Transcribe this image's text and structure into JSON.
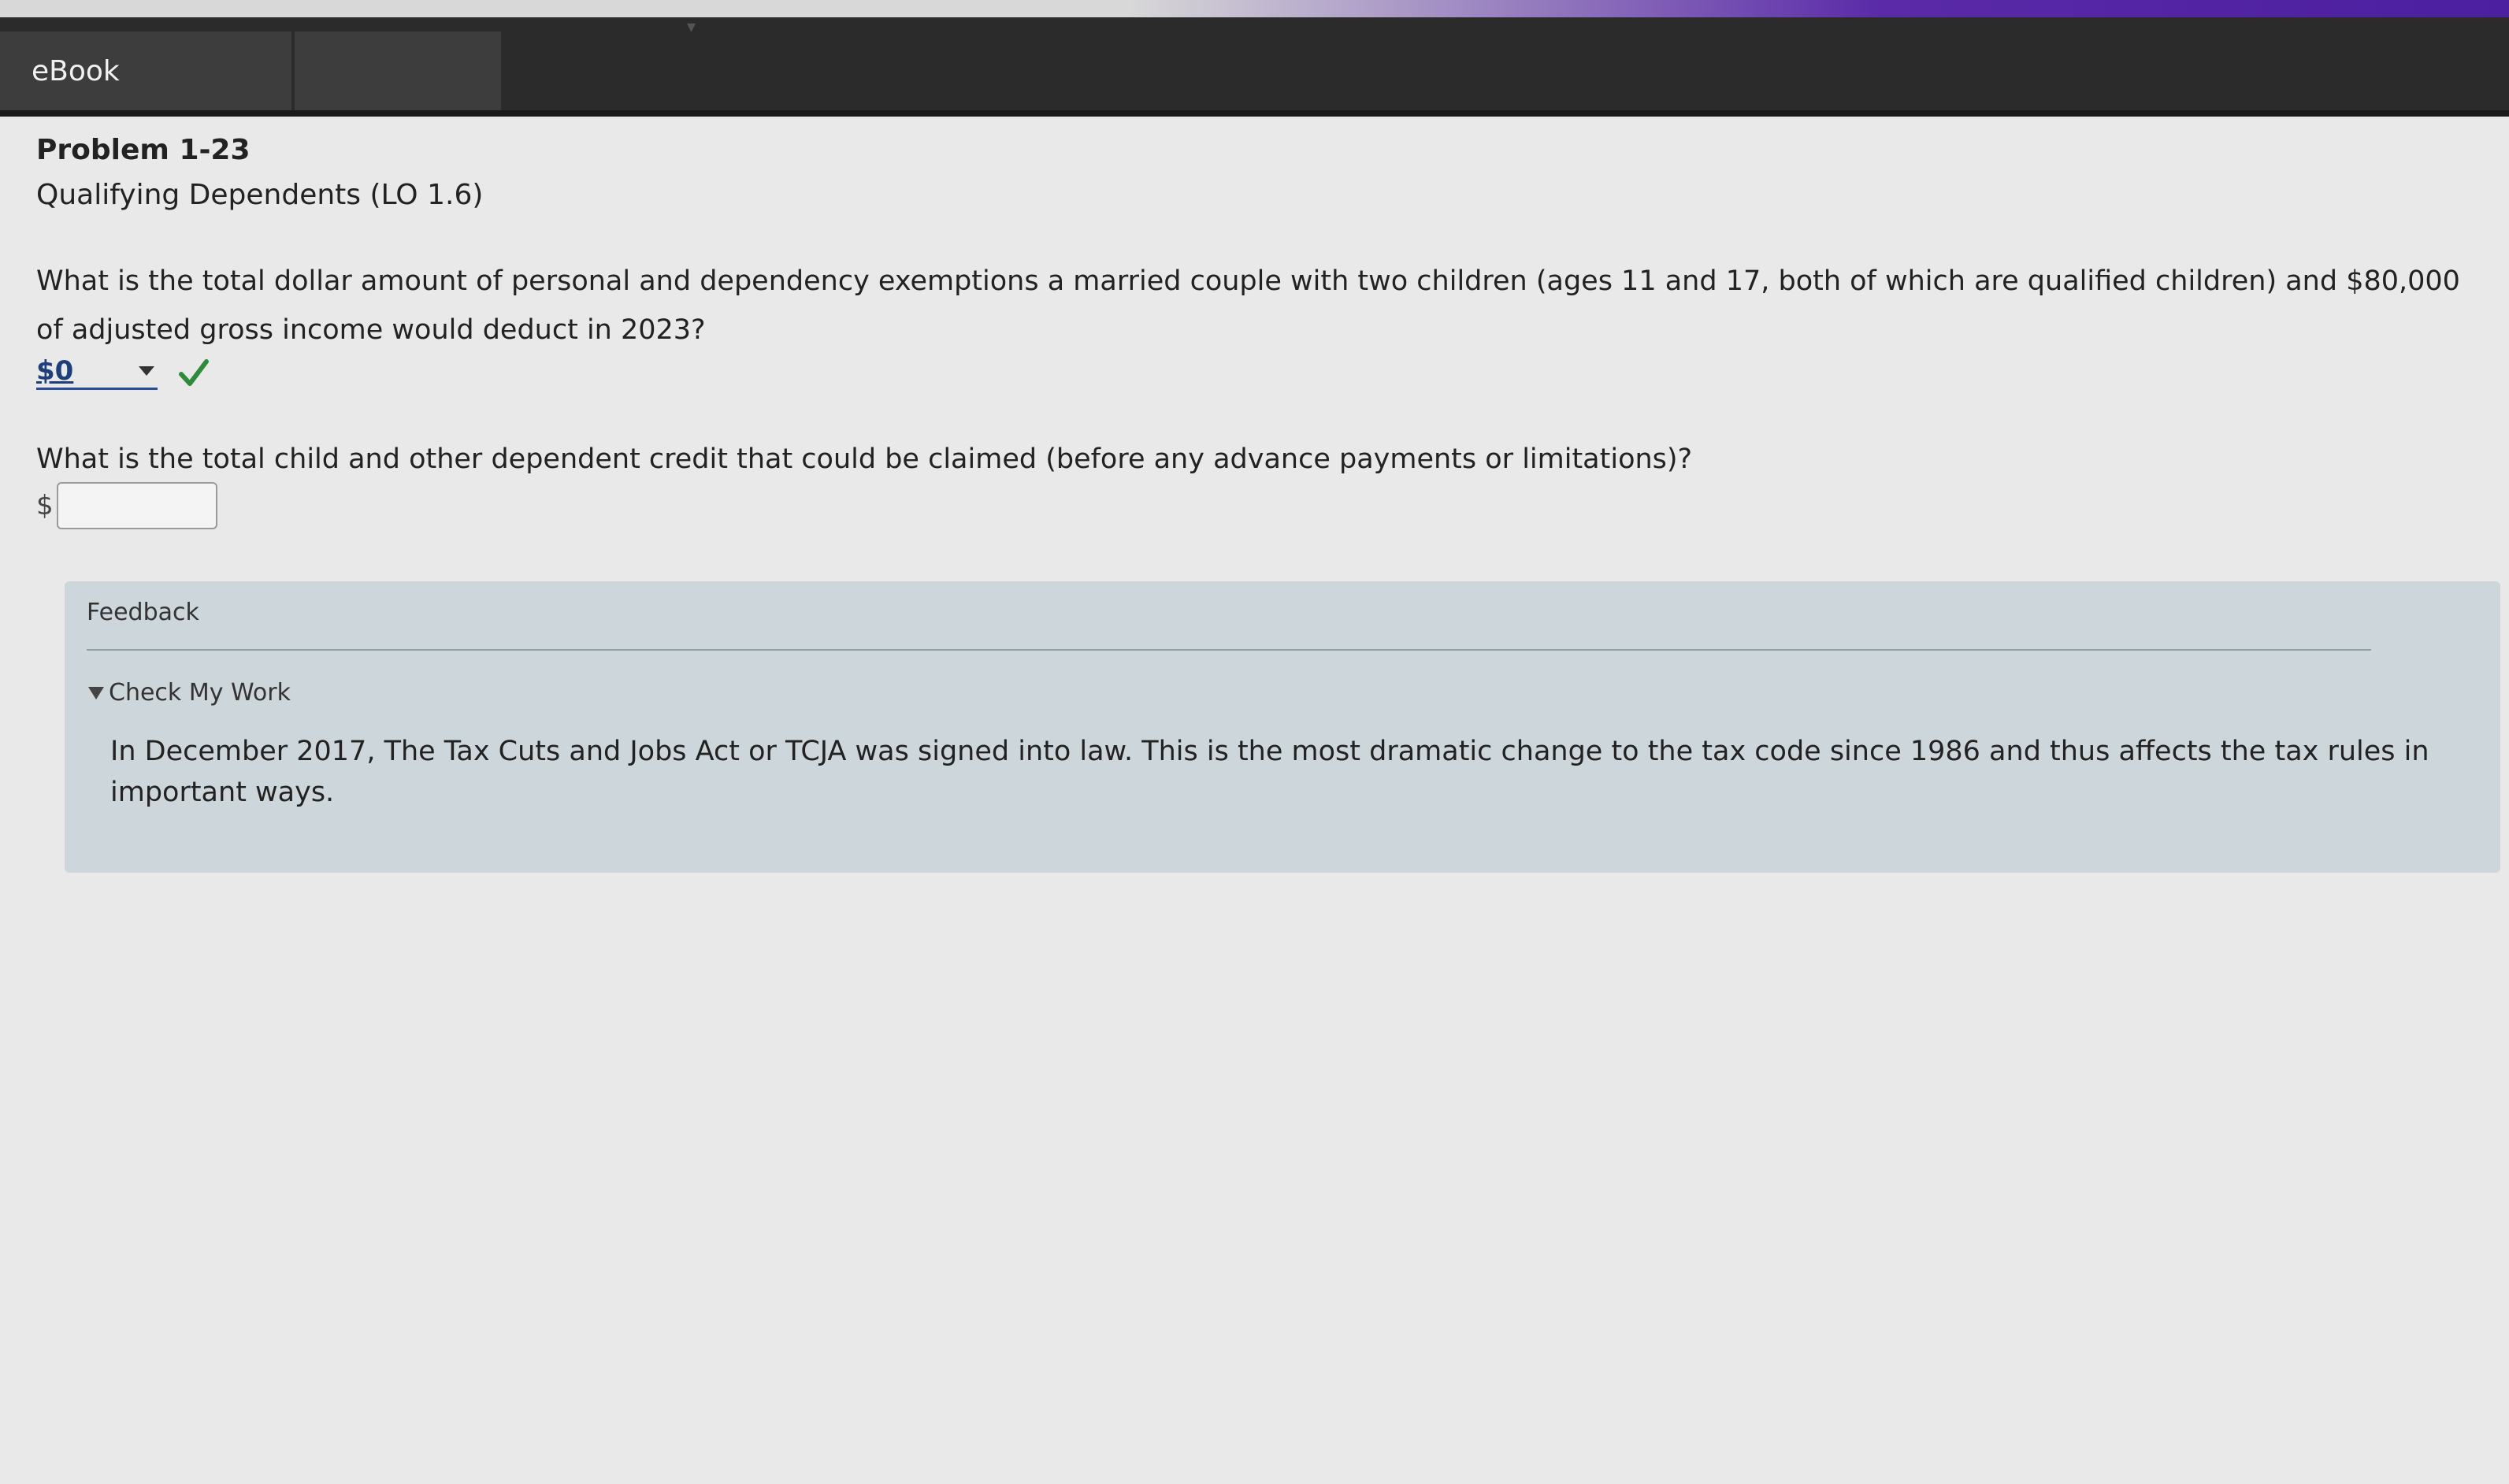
{
  "tabs": [
    {
      "label": "eBook"
    },
    {
      "label": ""
    }
  ],
  "colors": {
    "accent": "#4b1fa0",
    "tabbar": "#2b2b2b",
    "check": "#2e8b3a",
    "feedback_bg": "#ccd6db"
  },
  "problem": {
    "title": "Problem 1-23",
    "subtitle": "Qualifying Dependents (LO 1.6)"
  },
  "question1": {
    "text": "What is the total dollar amount of personal and dependency exemptions a married couple with two children (ages 11 and 17, both of which are qualified children) and $80,000 of adjusted gross income would deduct in 2023?",
    "selected_value": "$0",
    "status_icon": "check-icon"
  },
  "question2": {
    "text": "What is the total child and other dependent credit that could be claimed (before any advance payments or limitations)?",
    "currency": "$",
    "value": ""
  },
  "feedback": {
    "title": "Feedback",
    "toggle_label": "Check My Work",
    "text": "In December 2017, The Tax Cuts and Jobs Act or TCJA was signed into law. This is the most dramatic change to the tax code since 1986 and thus affects the tax rules in important ways."
  }
}
